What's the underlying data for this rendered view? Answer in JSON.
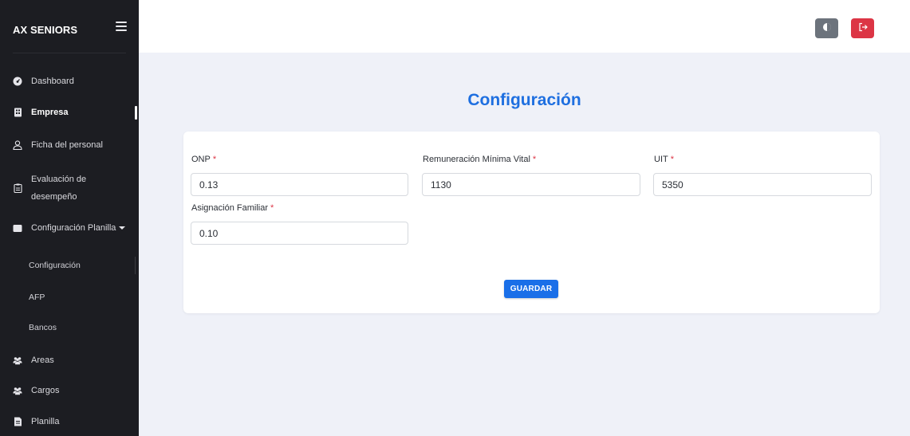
{
  "sidebar": {
    "brand": "AX SENIORS",
    "items": [
      {
        "label": "Dashboard",
        "icon": "dashboard-gauge-icon"
      },
      {
        "label": "Empresa",
        "icon": "building-icon"
      },
      {
        "label": "Ficha del personal",
        "icon": "user-icon"
      },
      {
        "label_line1": "Evaluación de",
        "label_line2": "desempeño",
        "icon": "clipboard-icon"
      },
      {
        "label": "Configuración Planilla",
        "icon": "wallet-icon"
      },
      {
        "label": "Areas",
        "icon": "users-group-icon"
      },
      {
        "label": "Cargos",
        "icon": "users-group-icon"
      },
      {
        "label": "Planilla",
        "icon": "document-icon"
      }
    ],
    "subitems": [
      "Configuración",
      "AFP",
      "Bancos"
    ]
  },
  "header": {
    "theme_toggle_icon": "contrast-icon",
    "logout_icon": "sign-out-icon",
    "colors": {
      "theme_button": "#6c737c",
      "logout_button": "#dc3545"
    }
  },
  "main": {
    "title": "Configuración",
    "form": {
      "onp": {
        "label": "ONP",
        "required_mark": "*",
        "value": "0.13"
      },
      "rmv": {
        "label": "Remuneración Mínima Vital",
        "required_mark": "*",
        "value": "1130"
      },
      "uit": {
        "label": "UIT",
        "required_mark": "*",
        "value": "5350"
      },
      "asignacion": {
        "label": "Asignación Familiar",
        "required_mark": "*",
        "value": "0.10"
      }
    },
    "save_label": "GUARDAR"
  },
  "colors": {
    "accent": "#1a6fe8",
    "title": "#1e6fe0",
    "sidebar_bg": "#1c1d22",
    "main_bg": "#eff1f8"
  }
}
